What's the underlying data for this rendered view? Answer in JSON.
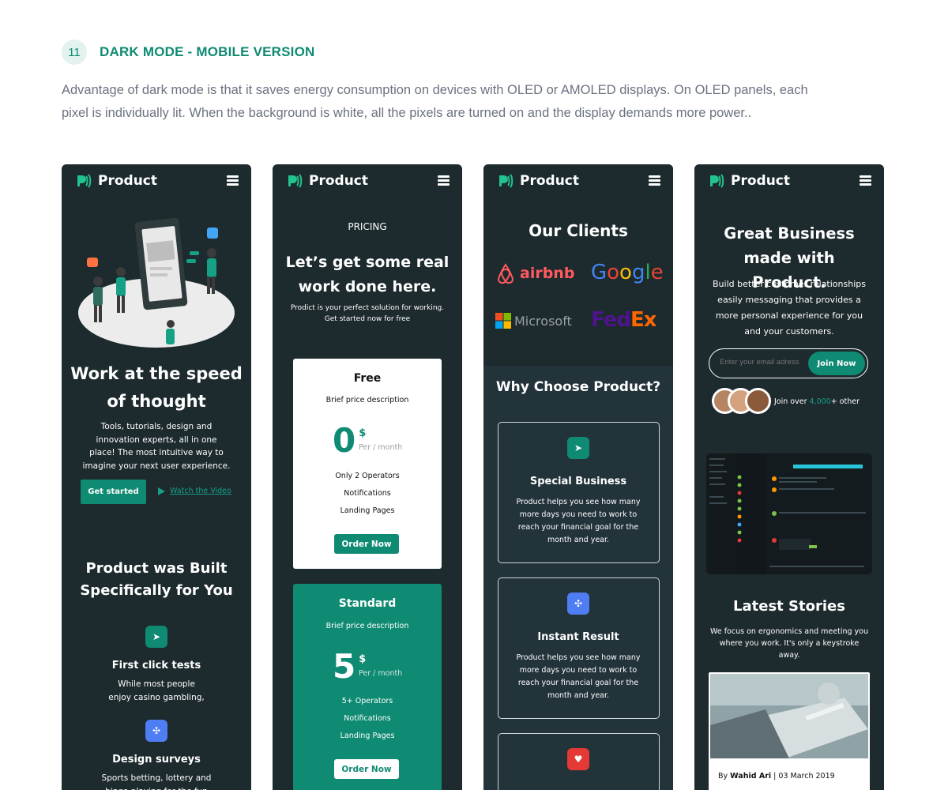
{
  "section": {
    "number": "11",
    "title": "DARK MODE - MOBILE VERSION",
    "intro": "Advantage of dark mode is that it saves energy consumption on devices with OLED or AMOLED displays. On OLED panels, each pixel is individually lit. When the background is white, all the pixels are turned on and the display demands more power.."
  },
  "brand": {
    "name": "Product",
    "accent": "#0f8a73",
    "bg": "#1d2a2e"
  },
  "screen1": {
    "hero_title": "Work at the speed of thought",
    "hero_text": "Tools, tutorials, design and innovation experts, all in one place! The most intuitive way to imagine your next user experience.",
    "cta_label": "Get started",
    "watch_label": "Watch the Video",
    "built_title": "Product  was Built Specifically for You",
    "features": [
      {
        "icon": "cursor-icon",
        "title": "First click tests",
        "text": "While most people enjoy casino gambling,"
      },
      {
        "icon": "stumbleupon-icon",
        "title": "Design surveys",
        "text": "Sports betting, lottery and bingo playing for the fun"
      }
    ]
  },
  "screen2": {
    "eyebrow": "PRICING",
    "title": "Let’s get some real work done here.",
    "subtitle": "Prodict is your perfect solution for working. Get started now for free",
    "plans": [
      {
        "name": "Free",
        "desc": "Brief price description",
        "price": "0",
        "currency": "$",
        "period": "Per / month",
        "features": [
          "Only 2 Operators",
          "Notifications",
          "Landing Pages"
        ],
        "button": "Order Now"
      },
      {
        "name": "Standard",
        "desc": "Brief price description",
        "price": "5",
        "currency": "$",
        "period": "Per / month",
        "features": [
          "5+ Operators",
          "Notifications",
          "Landing Pages"
        ],
        "button": "Order Now"
      }
    ]
  },
  "screen3": {
    "clients_title": "Our Clients",
    "clients": [
      "airbnb",
      "Google",
      "Microsoft",
      "FedEx"
    ],
    "why_title": "Why Choose Product?",
    "cards": [
      {
        "icon": "cursor-icon",
        "title": "Special Business",
        "text": "Product helps you see how many more days you need to work to reach your financial goal for the month and year."
      },
      {
        "icon": "stumbleupon-icon",
        "title": "Instant Result",
        "text": "Product helps you see how many more days you need to work to reach your financial goal for the month and year."
      },
      {
        "icon": "heart-icon",
        "title": "",
        "text": ""
      }
    ]
  },
  "screen4": {
    "title": "Great Business made with Product.",
    "text": "Build better customer relationships easily messaging that provides a more personal experience for you and your customers.",
    "email_placeholder": "Enter your email adress",
    "join_button": "Join Now",
    "join_prefix": "Join over ",
    "join_count": "4,000",
    "join_suffix": "+ other",
    "stories_title": "Latest Stories",
    "stories_text": "We focus on ergonomics and meeting you where you work. It's only a keystroke away.",
    "story_by": "By ",
    "story_author": "Wahid Ari",
    "story_date": " |  03 March 2019"
  }
}
